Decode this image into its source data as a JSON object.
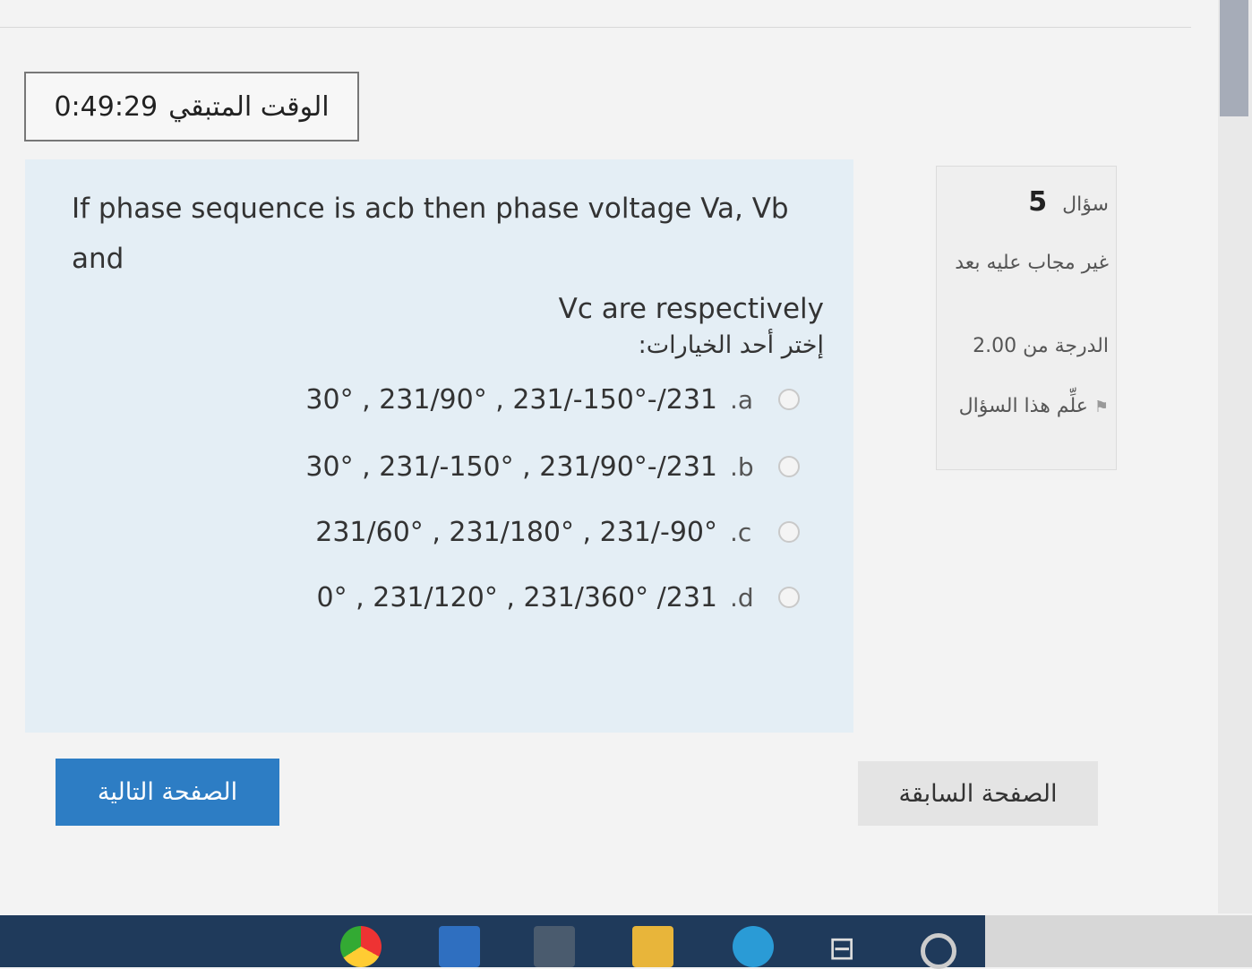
{
  "timer": {
    "label": "الوقت المتبقي",
    "value": "0:49:29"
  },
  "question_info": {
    "label": "سؤال",
    "number": "5",
    "status": "غير مجاب عليه بعد",
    "mark_label": "الدرجة من 2.00",
    "flag_label": "علِّم هذا السؤال"
  },
  "question": {
    "line1": "If phase sequence is acb then phase voltage Va, Vb and",
    "line2": "Vc are respectively"
  },
  "prompt": "إختر أحد الخيارات:",
  "options": [
    {
      "letter": ".a",
      "text": "30° , 231/90° , 231/-150°-/231"
    },
    {
      "letter": ".b",
      "text": "30° , 231/-150° , 231/90°-/231"
    },
    {
      "letter": ".c",
      "text": "231/60° , 231/180° , 231/-90°"
    },
    {
      "letter": ".d",
      "text": "0° , 231/120° , 231/360° /231"
    }
  ],
  "nav": {
    "next": "الصفحة التالية",
    "previous": "الصفحة السابقة"
  },
  "taskbar": [
    "chrome-icon",
    "mail-icon",
    "store-icon",
    "files-icon",
    "edge-icon",
    "taskview-icon",
    "cortana-icon"
  ]
}
